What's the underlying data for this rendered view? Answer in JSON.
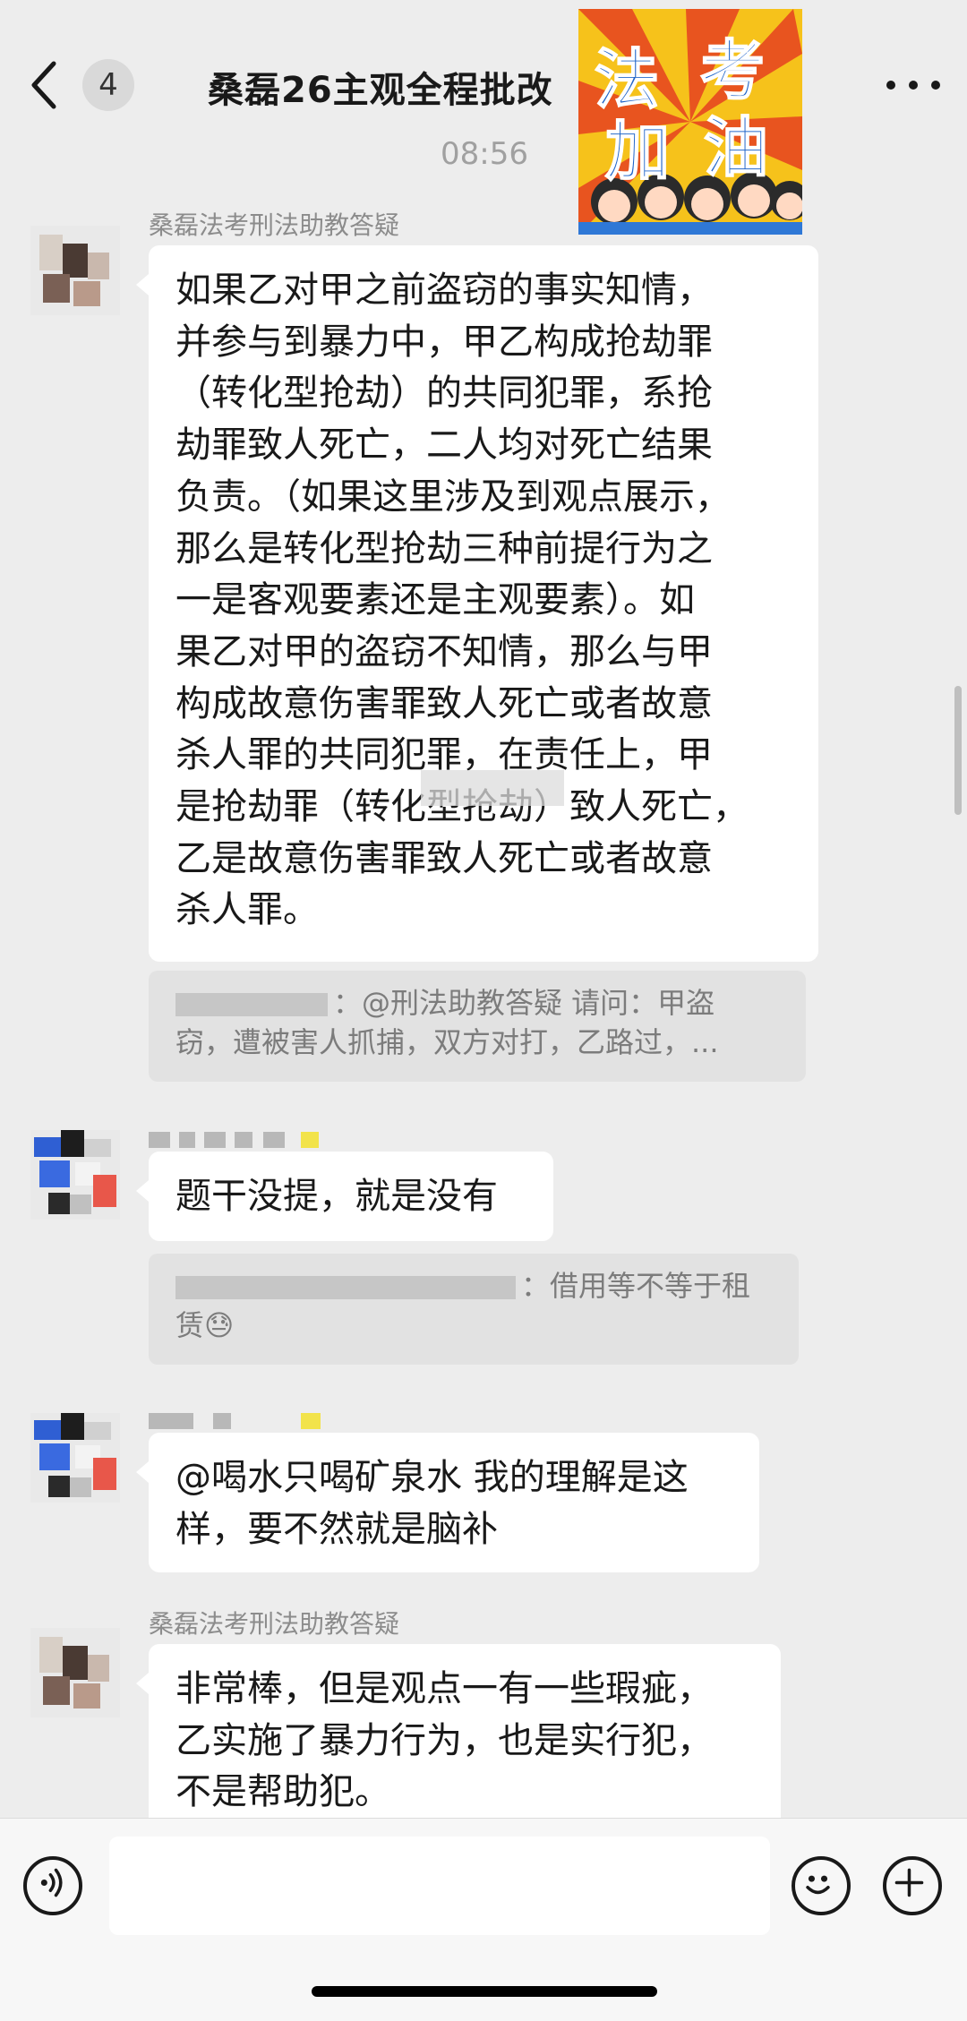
{
  "header": {
    "unread_count": "4",
    "title": "桑磊26主观全程批改",
    "sticker_text": [
      "法",
      "考",
      "加",
      "油"
    ]
  },
  "chat": {
    "timestamp": "08:56",
    "messages": [
      {
        "sender": "桑磊法考刑法助教答疑",
        "lines": [
          "如果乙对甲之前盗窃的事实知情，",
          "并参与到暴力中，甲乙构成抢劫罪",
          "（转化型抢劫）的共同犯罪，系抢",
          "劫罪致人死亡，二人均对死亡结果",
          "负责。（如果这里涉及到观点展示，",
          "那么是转化型抢劫三种前提行为之",
          "一是客观要素还是主观要素）。如",
          "果乙对甲的盗窃不知情，那么与甲",
          "构成故意伤害罪致人死亡或者故意",
          "杀人罪的共同犯罪，在责任上，甲",
          "是抢劫罪（转化型抢劫）致人死亡，",
          "乙是故意伤害罪致人死亡或者故意",
          "杀人罪。"
        ],
        "quote_line1": "：@刑法助教答疑 请问：甲盗",
        "quote_line2": "窃，遭被害人抓捕，双方对打，乙路过，..."
      },
      {
        "text": "题干没提，就是没有",
        "quote_line1": "：借用等不等于租",
        "quote_line2": "赁😓"
      },
      {
        "lines": [
          "@喝水只喝矿泉水 我的理解是这",
          "样，要不然就是脑补"
        ]
      },
      {
        "sender": "桑磊法考刑法助教答疑",
        "lines": [
          "非常棒，但是观点一有一些瑕疵，",
          "乙实施了暴力行为，也是实行犯，",
          "不是帮助犯。"
        ]
      }
    ]
  },
  "input_bar": {
    "placeholder": ""
  }
}
